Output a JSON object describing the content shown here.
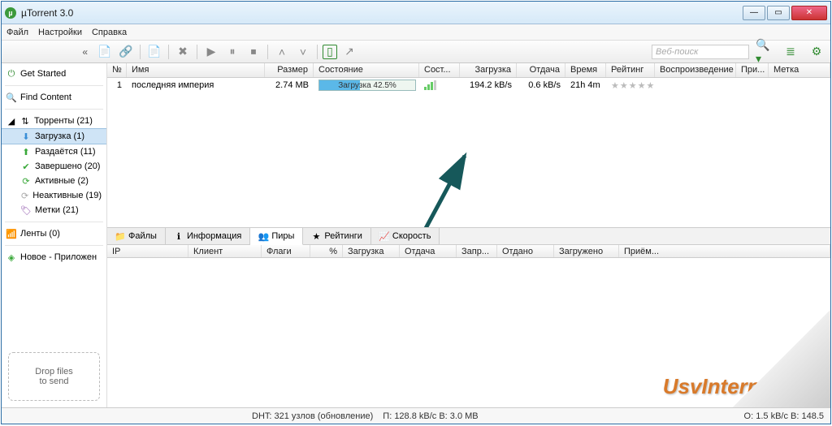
{
  "title": "µTorrent 3.0",
  "menu": [
    "Файл",
    "Настройки",
    "Справка"
  ],
  "search_placeholder": "Веб-поиск",
  "sidebar": {
    "get_started": "Get Started",
    "find_content": "Find Content",
    "torrents": "Торренты (21)",
    "items": [
      {
        "label": "Загрузка (1)"
      },
      {
        "label": "Раздаётся (11)"
      },
      {
        "label": "Завершено (20)"
      },
      {
        "label": "Активные (2)"
      },
      {
        "label": "Неактивные (19)"
      },
      {
        "label": "Метки (21)"
      }
    ],
    "feeds": "Ленты (0)",
    "apps": "Новое - Приложен",
    "dropzone": "Drop files\nto send"
  },
  "columns": {
    "num": "№",
    "name": "Имя",
    "size": "Размер",
    "state": "Состояние",
    "health": "Сост...",
    "down": "Загрузка",
    "up": "Отдача",
    "eta": "Время",
    "rating": "Рейтинг",
    "playback": "Воспроизведение",
    "pri": "При...",
    "label": "Метка"
  },
  "torrent": {
    "num": "1",
    "name": "последняя империя",
    "size": "2.74 MB",
    "state_text": "Загрузка 42.5%",
    "progress_pct": 42.5,
    "down": "194.2 kB/s",
    "up": "0.6 kB/s",
    "eta": "21h 4m",
    "rating": "★★★★★"
  },
  "detail_tabs": [
    "Файлы",
    "Информация",
    "Пиры",
    "Рейтинги",
    "Скорость"
  ],
  "detail_cols": [
    "IP",
    "Клиент",
    "Флаги",
    "%",
    "Загрузка",
    "Отдача",
    "Запр...",
    "Отдано",
    "Загружено",
    "Приём..."
  ],
  "status": {
    "dht": "DHT: 321 узлов  (обновление)",
    "rates": "П: 128.8 kB/с В: 3.0 MB",
    "out": "О: 1.5 kB/с В: 148.5"
  },
  "watermark": "UsvInternet.ru"
}
